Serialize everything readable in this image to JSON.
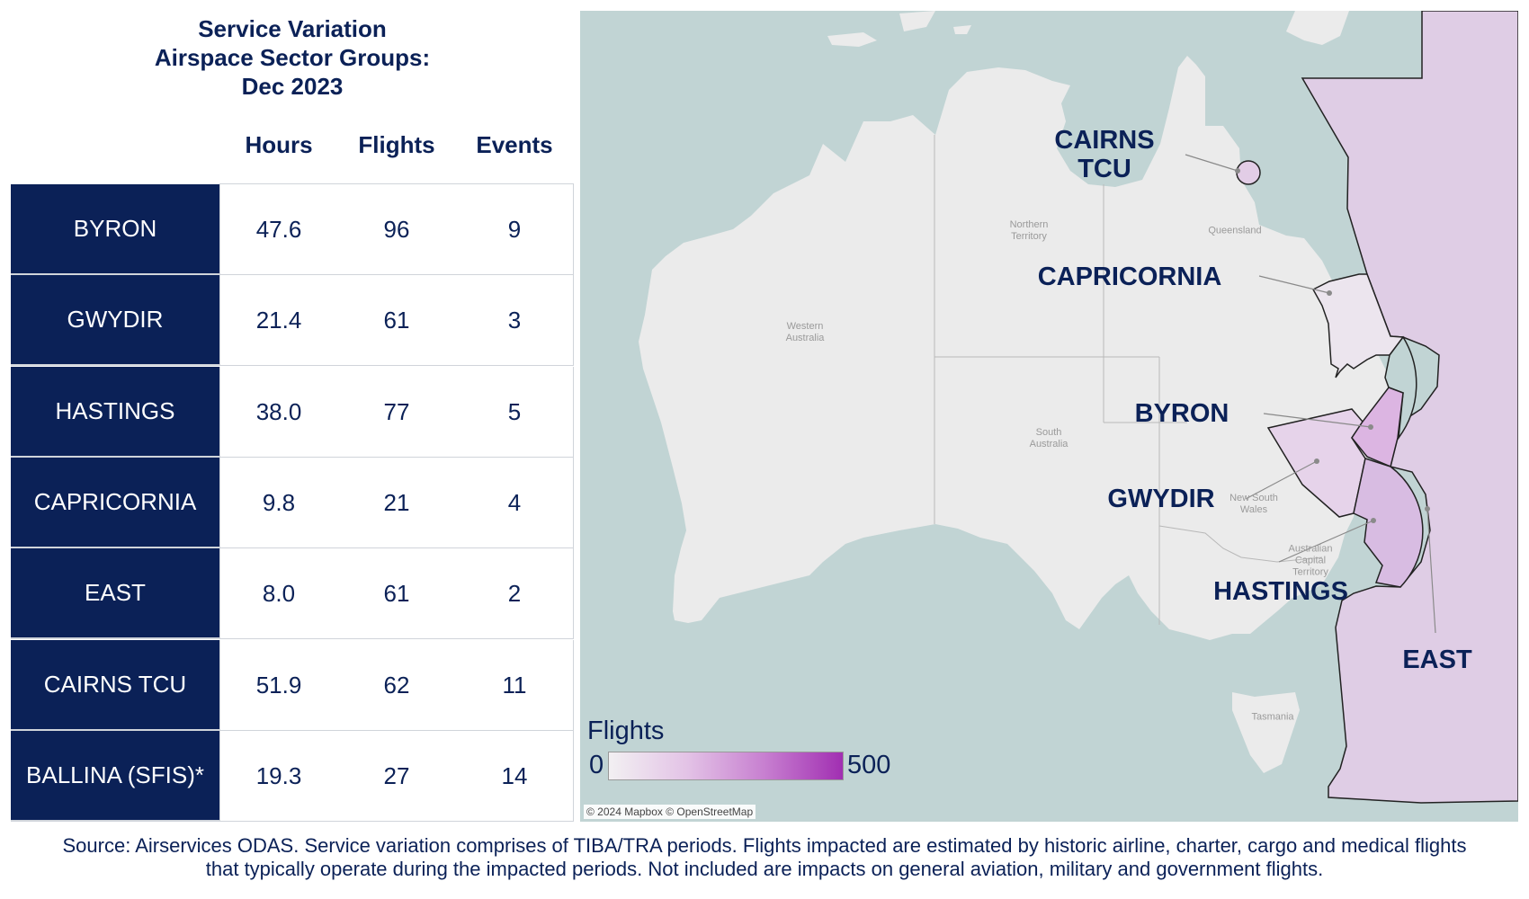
{
  "title": {
    "line1": "Service Variation",
    "line2": "Airspace Sector Groups:",
    "line3": "Dec 2023"
  },
  "table": {
    "columns": [
      "Hours",
      "Flights",
      "Events"
    ],
    "rows": [
      {
        "name": "BYRON",
        "hours": "47.6",
        "flights": "96",
        "events": "9"
      },
      {
        "name": "GWYDIR",
        "hours": "21.4",
        "flights": "61",
        "events": "3"
      },
      {
        "name": "HASTINGS",
        "hours": "38.0",
        "flights": "77",
        "events": "5"
      },
      {
        "name": "CAPRICORNIA",
        "hours": "9.8",
        "flights": "21",
        "events": "4"
      },
      {
        "name": "EAST",
        "hours": "8.0",
        "flights": "61",
        "events": "2"
      },
      {
        "name": "CAIRNS TCU",
        "hours": "51.9",
        "flights": "62",
        "events": "11"
      },
      {
        "name": "BALLINA (SFIS)*",
        "hours": "19.3",
        "flights": "27",
        "events": "14"
      }
    ]
  },
  "map": {
    "sector_labels": {
      "cairns_line1": "CAIRNS",
      "cairns_line2": "TCU",
      "capricornia": "CAPRICORNIA",
      "byron": "BYRON",
      "gwydir": "GWYDIR",
      "hastings": "HASTINGS",
      "east": "EAST"
    },
    "state_labels": {
      "wa_1": "Western",
      "wa_2": "Australia",
      "nt_1": "Northern",
      "nt_2": "Territory",
      "qld": "Queensland",
      "sa_1": "South",
      "sa_2": "Australia",
      "nsw_1": "New South",
      "nsw_2": "Wales",
      "act_1": "Australian",
      "act_2": "Capital",
      "act_3": "Territory",
      "tas": "Tasmania"
    },
    "colors": {
      "sea": "#c1d4d4",
      "land": "#ebebeb",
      "low": "#f2f0f2",
      "high": "#a12fb2",
      "label": "#0b2157"
    },
    "legend": {
      "title": "Flights",
      "min": "0",
      "max": "500"
    },
    "attribution": "© 2024 Mapbox © OpenStreetMap"
  },
  "source": {
    "line1": "Source: Airservices ODAS. Service variation comprises of TIBA/TRA periods. Flights impacted are estimated by historic airline, charter, cargo and medical flights",
    "line2": "that typically operate during the impacted periods. Not included are impacts on general aviation, military and government flights."
  }
}
